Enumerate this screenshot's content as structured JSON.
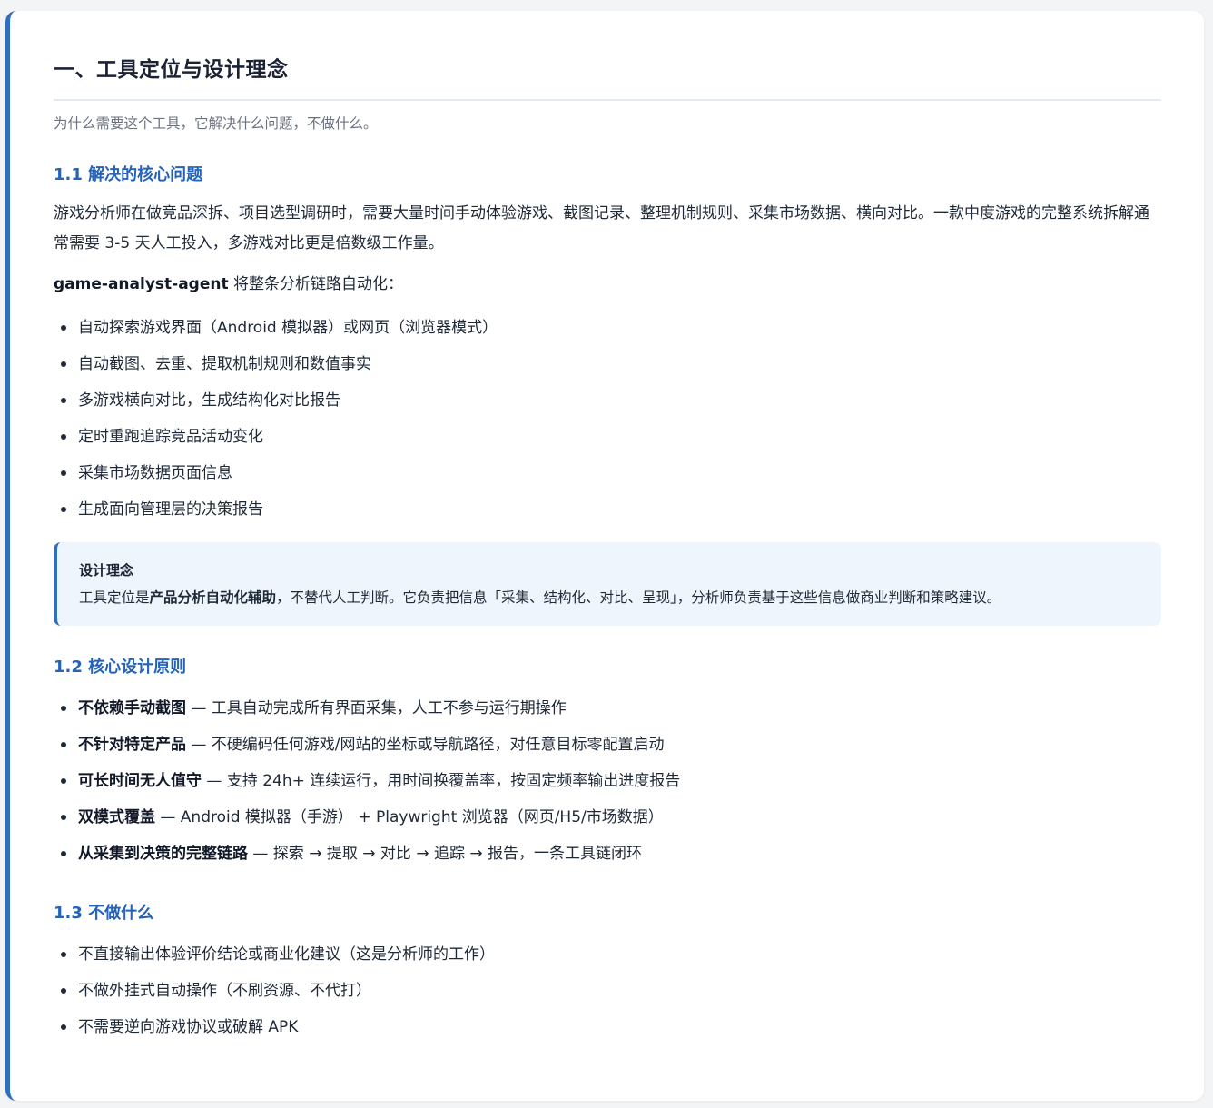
{
  "section": {
    "title": "一、工具定位与设计理念",
    "subtitle": "为什么需要这个工具，它解决什么问题，不做什么。"
  },
  "s11": {
    "heading": "1.1 解决的核心问题",
    "paragraph": "游戏分析师在做竞品深拆、项目选型调研时，需要大量时间手动体验游戏、截图记录、整理机制规则、采集市场数据、横向对比。一款中度游戏的完整系统拆解通常需要 3-5 天人工投入，多游戏对比更是倍数级工作量。",
    "agent_name": "game-analyst-agent",
    "agent_suffix": " 将整条分析链路自动化：",
    "items": [
      "自动探索游戏界面（Android 模拟器）或网页（浏览器模式）",
      "自动截图、去重、提取机制规则和数值事实",
      "多游戏横向对比，生成结构化对比报告",
      "定时重跑追踪竞品活动变化",
      "采集市场数据页面信息",
      "生成面向管理层的决策报告"
    ],
    "callout": {
      "title": "设计理念",
      "text_before": "工具定位是",
      "text_bold": "产品分析自动化辅助",
      "text_after": "，不替代人工判断。它负责把信息「采集、结构化、对比、呈现」，分析师负责基于这些信息做商业判断和策略建议。"
    }
  },
  "s12": {
    "heading": "1.2 核心设计原则",
    "items": [
      {
        "bold": "不依赖手动截图",
        "rest": " — 工具自动完成所有界面采集，人工不参与运行期操作"
      },
      {
        "bold": "不针对特定产品",
        "rest": " — 不硬编码任何游戏/网站的坐标或导航路径，对任意目标零配置启动"
      },
      {
        "bold": "可长时间无人值守",
        "rest": " — 支持 24h+ 连续运行，用时间换覆盖率，按固定频率输出进度报告"
      },
      {
        "bold": "双模式覆盖",
        "rest": " — Android 模拟器（手游） + Playwright 浏览器（网页/H5/市场数据）"
      },
      {
        "bold": "从采集到决策的完整链路",
        "rest": " — 探索 → 提取 → 对比 → 追踪 → 报告，一条工具链闭环"
      }
    ]
  },
  "s13": {
    "heading": "1.3 不做什么",
    "items": [
      "不直接输出体验评价结论或商业化建议（这是分析师的工作）",
      "不做外挂式自动操作（不刷资源、不代打）",
      "不需要逆向游戏协议或破解 APK"
    ]
  }
}
